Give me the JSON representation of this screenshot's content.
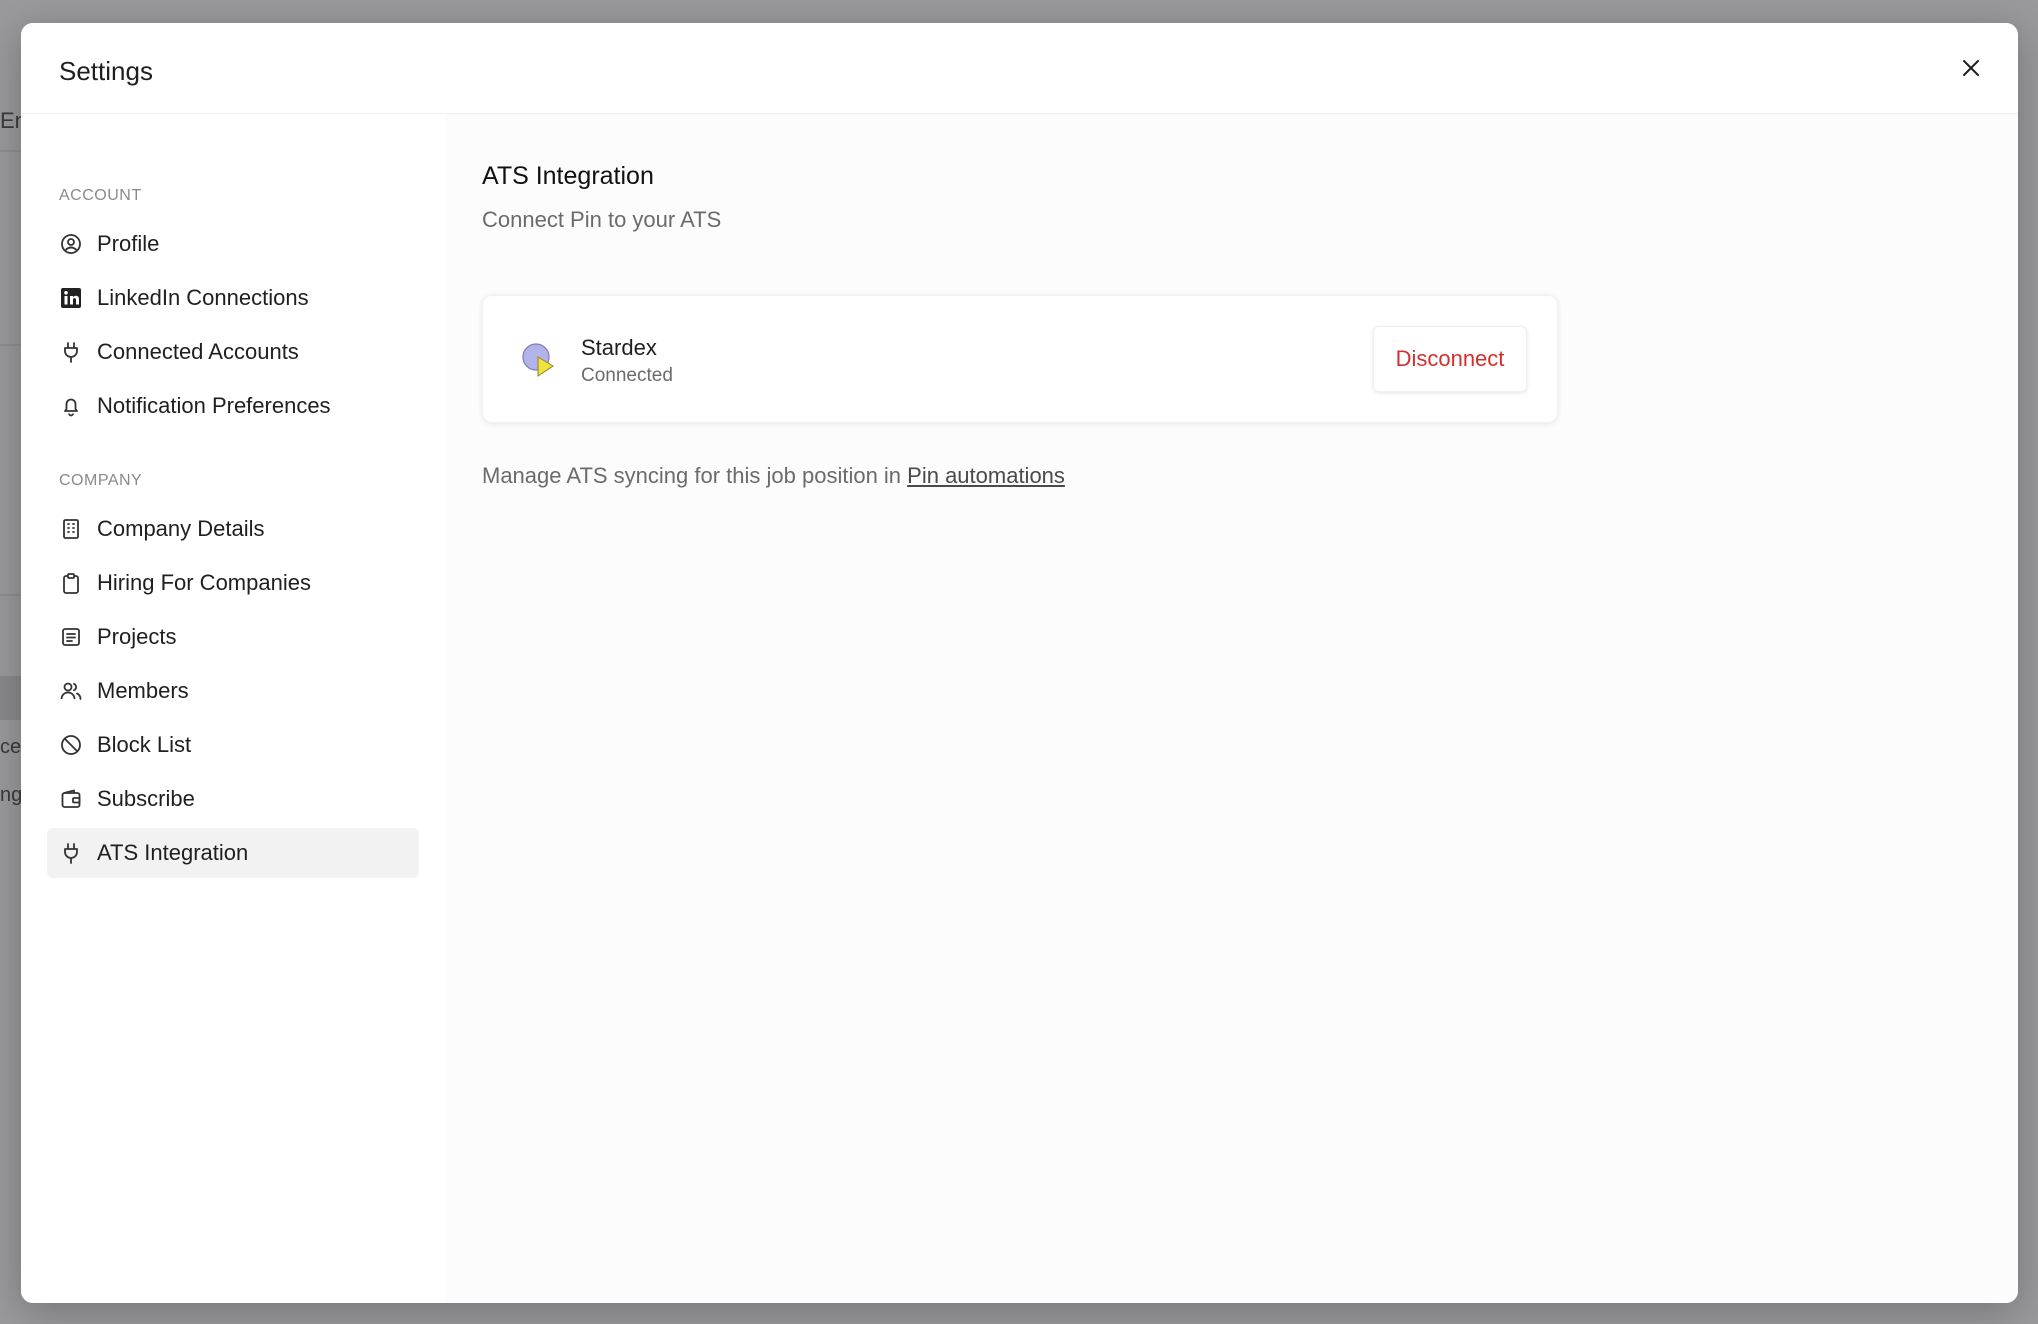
{
  "background": {
    "fragments": [
      "En",
      "ce",
      "ng"
    ]
  },
  "modal": {
    "title": "Settings",
    "close_label": "close"
  },
  "sidebar": {
    "account_label": "ACCOUNT",
    "company_label": "COMPANY",
    "account_items": [
      {
        "label": "Profile",
        "icon": "user-circle-icon"
      },
      {
        "label": "LinkedIn Connections",
        "icon": "linkedin-icon"
      },
      {
        "label": "Connected Accounts",
        "icon": "plug-icon"
      },
      {
        "label": "Notification Preferences",
        "icon": "bell-icon"
      }
    ],
    "company_items": [
      {
        "label": "Company Details",
        "icon": "building-icon"
      },
      {
        "label": "Hiring For Companies",
        "icon": "clipboard-icon"
      },
      {
        "label": "Projects",
        "icon": "document-icon"
      },
      {
        "label": "Members",
        "icon": "users-icon"
      },
      {
        "label": "Block List",
        "icon": "ban-icon"
      },
      {
        "label": "Subscribe",
        "icon": "wallet-icon"
      },
      {
        "label": "ATS Integration",
        "icon": "plug-icon",
        "active": true
      }
    ]
  },
  "content": {
    "title": "ATS Integration",
    "subtitle": "Connect Pin to your ATS",
    "integration": {
      "name": "Stardex",
      "status": "Connected",
      "action_label": "Disconnect",
      "action_color": "#d32f2f"
    },
    "manage_prefix": "Manage ATS syncing for this job position in ",
    "manage_link": "Pin automations"
  }
}
